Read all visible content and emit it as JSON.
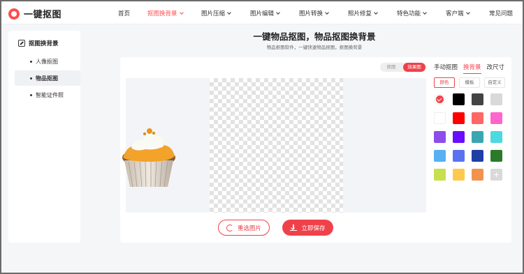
{
  "app": {
    "logo_text": "一键抠图"
  },
  "nav": {
    "items": [
      {
        "label": "首页",
        "active": false,
        "dropdown": false
      },
      {
        "label": "抠图换背景",
        "active": true,
        "dropdown": true
      },
      {
        "label": "图片压缩",
        "active": false,
        "dropdown": true
      },
      {
        "label": "图片编辑",
        "active": false,
        "dropdown": true
      },
      {
        "label": "图片转换",
        "active": false,
        "dropdown": true
      },
      {
        "label": "照片修复",
        "active": false,
        "dropdown": true
      },
      {
        "label": "特色功能",
        "active": false,
        "dropdown": true
      },
      {
        "label": "客户端",
        "active": false,
        "dropdown": true
      },
      {
        "label": "常见问题",
        "active": false,
        "dropdown": false
      }
    ]
  },
  "sidebar": {
    "title": "抠图换背景",
    "items": [
      {
        "label": "人像抠图",
        "active": false
      },
      {
        "label": "物品抠图",
        "active": true
      },
      {
        "label": "智能证件照",
        "active": false
      }
    ]
  },
  "main": {
    "title": "一键物品抠图，物品抠图换背景",
    "subtitle": "物品抠图软件，一键快速物品抠图，抠图换背景"
  },
  "toggle": {
    "left": "原图",
    "right": "效果图",
    "selected": "效果图"
  },
  "tool_tabs": [
    {
      "label": "手动抠图",
      "active": false
    },
    {
      "label": "换背景",
      "active": true
    },
    {
      "label": "改尺寸",
      "active": false
    }
  ],
  "sub_tabs": [
    {
      "label": "颜色",
      "active": true
    },
    {
      "label": "模板",
      "active": false
    },
    {
      "label": "自定义",
      "active": false
    }
  ],
  "colors": {
    "accent": "#f0414a",
    "swatches": [
      [
        "selected-transparent",
        "#000000",
        "#444444",
        "#d9d9d9"
      ],
      [
        "#ffffff",
        "#ff0000",
        "#ff6666",
        "#ff66cc"
      ],
      [
        "#8c4dea",
        "#6a0dff",
        "#3aa6b2",
        "#4dd9e0"
      ],
      [
        "#57b0f2",
        "#5a72f2",
        "#1f3ea8",
        "#2a7a2a"
      ],
      [
        "#c7e04e",
        "#ffc94d",
        "#f2934d",
        "add-custom"
      ]
    ]
  },
  "actions": {
    "reselect": "重选图片",
    "save": "立即保存"
  }
}
